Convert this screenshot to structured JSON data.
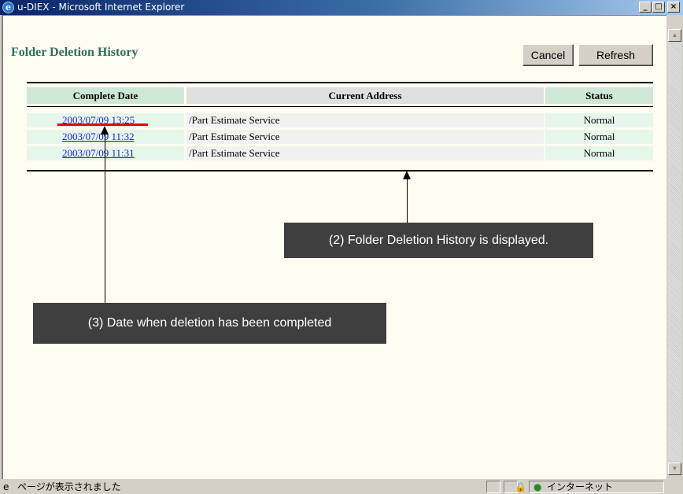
{
  "window": {
    "title": "u-DIEX - Microsoft Internet Explorer",
    "icon": "e-icon",
    "controls": [
      "_",
      "□",
      "×"
    ]
  },
  "page": {
    "title": "Folder Deletion History",
    "buttons": {
      "cancel": "Cancel",
      "refresh": "Refresh"
    }
  },
  "table": {
    "headers": {
      "date": "Complete Date",
      "address": "Current Address",
      "status": "Status"
    },
    "rows": [
      {
        "date": "2003/07/09 13:25",
        "address": "/Part Estimate Service",
        "status": "Normal"
      },
      {
        "date": "2003/07/09 11:32",
        "address": "/Part Estimate Service",
        "status": "Normal"
      },
      {
        "date": "2003/07/09 11:31",
        "address": "/Part Estimate Service",
        "status": "Normal"
      }
    ]
  },
  "annotations": {
    "callout2": "(2) Folder Deletion History is displayed.",
    "callout3": "(3) Date when deletion has been completed"
  },
  "statusbar": {
    "message": "ページが表示されました",
    "zone": "インターネット"
  },
  "colors": {
    "page_bg": "#fffdf2",
    "title_green": "#2e6e5e",
    "link_blue": "#1a1aee",
    "highlight_red": "#e60000",
    "callout_bg": "#3f3f3f"
  }
}
